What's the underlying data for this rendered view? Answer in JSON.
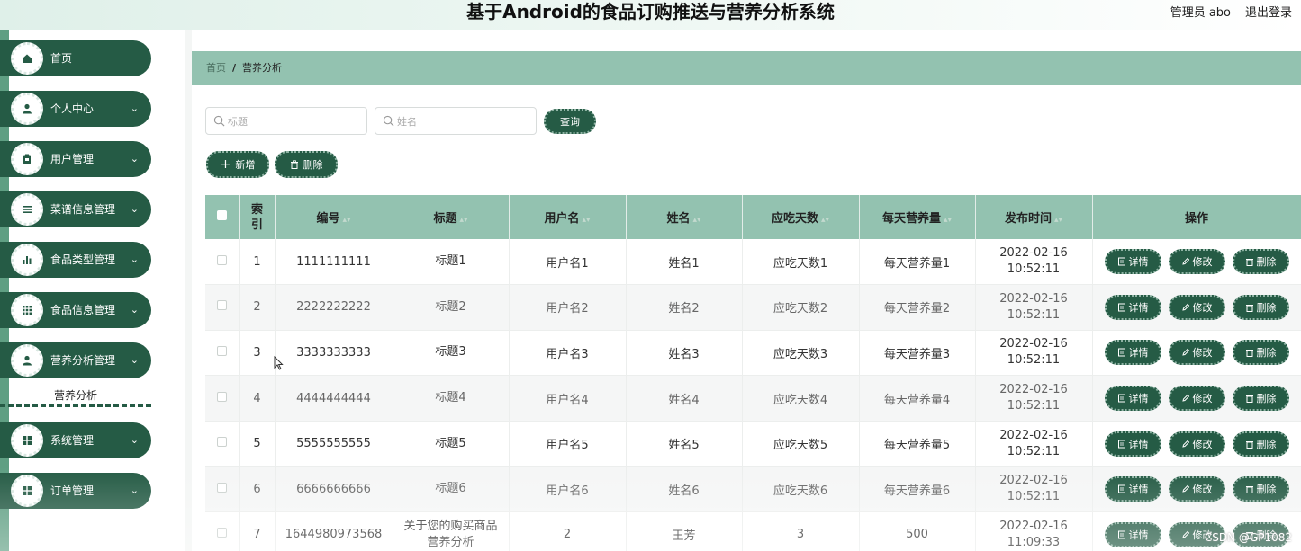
{
  "header": {
    "title": "基于Android的食品订购推送与营养分析系统",
    "user": "管理员 abo",
    "logout": "退出登录"
  },
  "sidebar": {
    "items": [
      {
        "label": "首页",
        "icon": "home-icon",
        "chevron": false
      },
      {
        "label": "个人中心",
        "icon": "user-icon",
        "chevron": true
      },
      {
        "label": "用户管理",
        "icon": "clipboard-icon",
        "chevron": true
      },
      {
        "label": "菜谱信息管理",
        "icon": "list-icon",
        "chevron": true
      },
      {
        "label": "食品类型管理",
        "icon": "bar-chart-icon",
        "chevron": true
      },
      {
        "label": "食品信息管理",
        "icon": "grid-icon",
        "chevron": true
      },
      {
        "label": "营养分析管理",
        "icon": "user-icon",
        "chevron": true
      },
      {
        "label": "系统管理",
        "icon": "apps-icon",
        "chevron": true
      },
      {
        "label": "订单管理",
        "icon": "apps-icon",
        "chevron": true
      }
    ],
    "submenu": "营养分析"
  },
  "breadcrumb": {
    "home": "首页",
    "sep": "/",
    "current": "营养分析"
  },
  "search": {
    "title_placeholder": "标题",
    "name_placeholder": "姓名",
    "query_label": "查询"
  },
  "actions": {
    "add_label": "新增",
    "delete_label": "删除"
  },
  "table": {
    "headers": [
      "索引",
      "编号",
      "标题",
      "用户名",
      "姓名",
      "应吃天数",
      "每天营养量",
      "发布时间",
      "操作"
    ],
    "op_labels": {
      "detail": "详情",
      "edit": "修改",
      "delete": "删除"
    },
    "rows": [
      {
        "index": "1",
        "code": "1111111111",
        "title": "标题1",
        "username": "用户名1",
        "name": "姓名1",
        "days": "应吃天数1",
        "nutrition": "每天营养量1",
        "time": "2022-02-16 10:52:11"
      },
      {
        "index": "2",
        "code": "2222222222",
        "title": "标题2",
        "username": "用户名2",
        "name": "姓名2",
        "days": "应吃天数2",
        "nutrition": "每天营养量2",
        "time": "2022-02-16 10:52:11"
      },
      {
        "index": "3",
        "code": "3333333333",
        "title": "标题3",
        "username": "用户名3",
        "name": "姓名3",
        "days": "应吃天数3",
        "nutrition": "每天营养量3",
        "time": "2022-02-16 10:52:11"
      },
      {
        "index": "4",
        "code": "4444444444",
        "title": "标题4",
        "username": "用户名4",
        "name": "姓名4",
        "days": "应吃天数4",
        "nutrition": "每天营养量4",
        "time": "2022-02-16 10:52:11"
      },
      {
        "index": "5",
        "code": "5555555555",
        "title": "标题5",
        "username": "用户名5",
        "name": "姓名5",
        "days": "应吃天数5",
        "nutrition": "每天营养量5",
        "time": "2022-02-16 10:52:11"
      },
      {
        "index": "6",
        "code": "6666666666",
        "title": "标题6",
        "username": "用户名6",
        "name": "姓名6",
        "days": "应吃天数6",
        "nutrition": "每天营养量6",
        "time": "2022-02-16 10:52:11"
      },
      {
        "index": "7",
        "code": "1644980973568",
        "title": "关于您的购买商品营养分析",
        "username": "2",
        "name": "王芳",
        "days": "3",
        "nutrition": "500",
        "time": "2022-02-16 11:09:33"
      }
    ]
  },
  "watermark": "CSDN @GP1082",
  "colors": {
    "brand": "#255b45",
    "accent": "#93c2b0"
  }
}
